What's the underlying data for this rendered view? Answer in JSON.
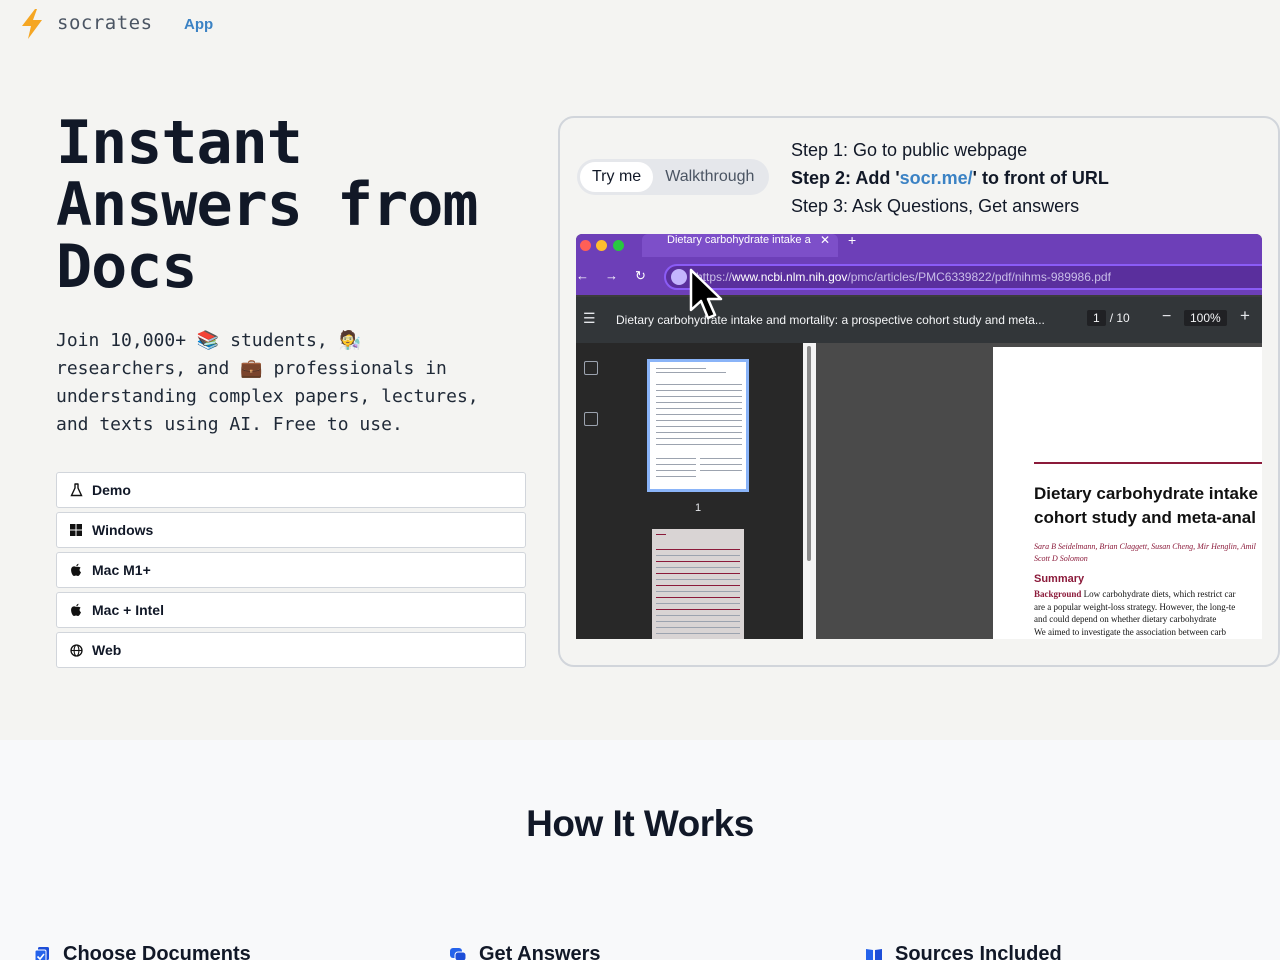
{
  "header": {
    "brand": "socrates",
    "nav_app": "App"
  },
  "hero": {
    "title_lines": [
      "Instant",
      "Answers from",
      "Docs"
    ],
    "subtitle_lines": [
      "Join 10,000+ 📚 students, 🧑‍🔬",
      "researchers, and 💼 professionals in",
      "understanding complex papers, lectures,",
      "and texts using AI. Free to use."
    ]
  },
  "downloads": [
    {
      "label": "Demo",
      "icon": "flask-icon"
    },
    {
      "label": "Windows",
      "icon": "windows-icon"
    },
    {
      "label": "Mac M1+",
      "icon": "apple-icon"
    },
    {
      "label": "Mac + Intel",
      "icon": "apple-icon"
    },
    {
      "label": "Web",
      "icon": "globe-icon"
    }
  ],
  "demo": {
    "tabs": [
      "Try me",
      "Walkthrough"
    ],
    "active_tab": "Try me",
    "step1": "Step 1: Go to public webpage",
    "step2_prefix": "Step 2: Add '",
    "step2_accent": "socr.me/",
    "step2_suffix": "' to front of URL",
    "step3": "Step 3: Ask Questions, Get answers",
    "browser": {
      "tab_title": "Dietary carbohydrate intake a",
      "url_prefix": "https://",
      "url_host": "www.ncbi.nlm.nih.gov",
      "url_path": "/pmc/articles/PMC6339822/pdf/nihms-989986.pdf",
      "pdf_title": "Dietary carbohydrate intake and mortality: a prospective cohort study and meta...",
      "page_current": "1",
      "page_total": "/ 10",
      "zoom": "100%",
      "thumb_label": "1",
      "paper_heading_1": "Dietary carbohydrate intake",
      "paper_heading_2": "cohort study and meta-anal",
      "paper_authors_1": "Sara B Seidelmann, Brian Claggett, Susan Cheng, Mir Henglin, Amil",
      "paper_authors_2": "Scott D Solomon",
      "paper_summary": "Summary",
      "paper_bg_label": "Background",
      "paper_body_1": " Low carbohydrate diets, which restrict car",
      "paper_body_2": "are a popular weight-loss strategy. However, the long-te",
      "paper_body_3": "and could depend on whether dietary carbohydrate",
      "paper_body_4": "We aimed to investigate the association between carb"
    }
  },
  "how": {
    "title": "How It Works",
    "features": [
      {
        "label": "Choose Documents",
        "icon": "document-check-icon"
      },
      {
        "label": "Get Answers",
        "icon": "chat-icon"
      },
      {
        "label": "Sources Included",
        "icon": "book-icon"
      }
    ]
  },
  "colors": {
    "accent": "#3b82c4",
    "bolt": "#f5a623",
    "browser_purple": "#6d3fb8",
    "paper_maroon": "#8b1a3a"
  }
}
